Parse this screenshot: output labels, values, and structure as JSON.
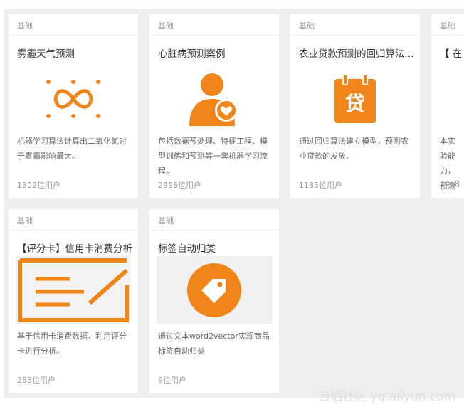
{
  "cards": [
    {
      "tag": "基础",
      "title": "雾霾天气预测",
      "icon": "infinity-dots-icon",
      "desc": "机器学习算法计算出二氧化氮对于雾霾影响最大。",
      "users": "1302位用户"
    },
    {
      "tag": "基础",
      "title": "心脏病预测案例",
      "icon": "person-heart-icon",
      "desc": "包括数据预处理、特征工程、模型训练和预测等一套机器学习流程。",
      "users": "2996位用户"
    },
    {
      "tag": "基础",
      "title": "农业贷款预测的回归算法...",
      "icon": "loan-clipboard-icon",
      "desc": "通过回归算法建立模型，预测农业贷款的发放。",
      "users": "1185位用户"
    },
    {
      "tag": "基础",
      "title": "【 在",
      "icon": "",
      "desc": "本实验能力，预测",
      "users": "1468"
    },
    {
      "tag": "基础",
      "title": "【评分卡】信用卡消费分析",
      "icon": "scorecard-icon",
      "desc": "基于信用卡消费数据，利用评分卡进行分析。",
      "users": "285位用户"
    },
    {
      "tag": "基础",
      "title": "标签自动归类",
      "icon": "price-tag-icon",
      "desc": "通过文本word2vector实现商品标签自动归类",
      "users": "9位用户"
    }
  ],
  "watermark": "云栖社区 yq.aliyun.com",
  "colors": {
    "accent": "#f08519",
    "background": "#eeeeee",
    "card": "#ffffff"
  }
}
